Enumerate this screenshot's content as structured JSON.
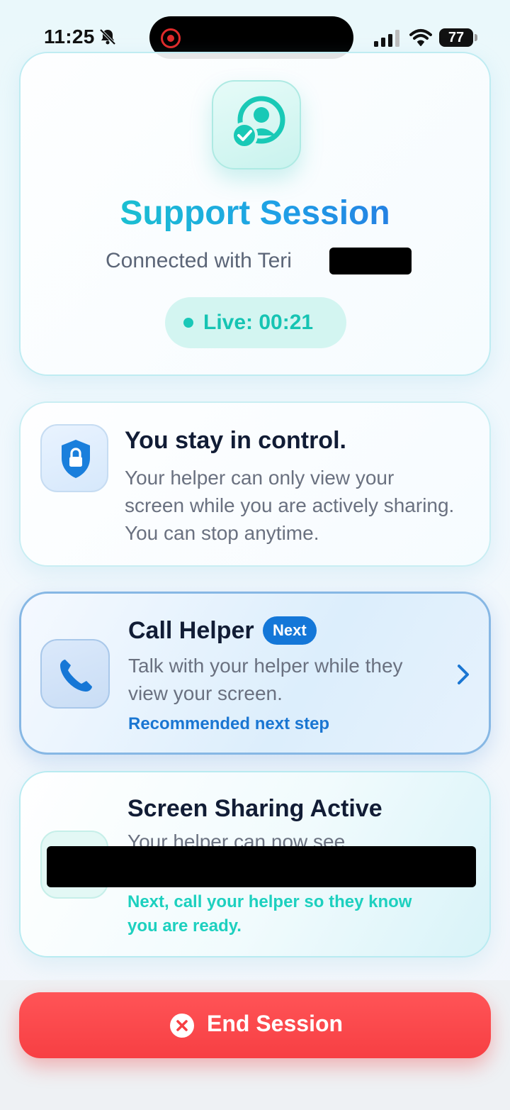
{
  "status_bar": {
    "time": "11:25",
    "battery": "77",
    "icons": [
      "bell-slash-icon",
      "screen-record-icon",
      "cellular-signal-icon",
      "wifi-icon",
      "battery-icon"
    ]
  },
  "session": {
    "title": "Support Session",
    "subtitle": "Connected with Teri",
    "live_label": "Live: 00:21",
    "icon": "support-person-check-icon"
  },
  "control": {
    "title": "You stay in control.",
    "body": "Your helper can only view your screen while you are actively sharing. You can stop anytime.",
    "icon": "shield-lock-icon"
  },
  "call_helper": {
    "title": "Call Helper",
    "badge": "Next",
    "body": "Talk with your helper while they view your screen.",
    "recommendation": "Recommended next step",
    "icon": "phone-icon"
  },
  "screen_sharing": {
    "title": "Screen Sharing Active",
    "body_partial": "Your helper can now see",
    "note": "Next, call your helper so they know you are ready."
  },
  "end_button": {
    "label": "End Session",
    "icon": "close-circle-icon"
  },
  "colors": {
    "accent_teal": "#16c4b3",
    "accent_blue": "#1477d8",
    "danger": "#f73f43"
  }
}
